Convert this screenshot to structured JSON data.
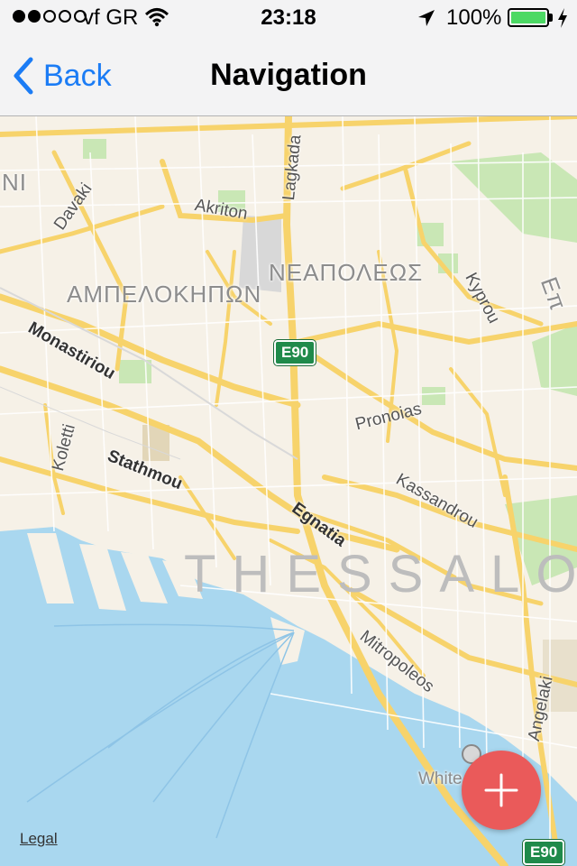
{
  "status_bar": {
    "carrier": "vf GR",
    "time": "23:18",
    "battery": "100%",
    "signal_filled": 2,
    "signal_total": 5,
    "icons": [
      "wifi-icon",
      "location-arrow-icon",
      "battery-icon",
      "charging-icon"
    ]
  },
  "nav": {
    "back_label": "Back",
    "title": "Navigation"
  },
  "map": {
    "streets": [
      "Lagkada",
      "Akriton",
      "Davaki",
      "Monastiriou",
      "Koletti",
      "Stathmou",
      "Egnatia",
      "Kassandrou",
      "Pronoias",
      "Kyprou",
      "Mitropoleos",
      "Angelaki"
    ],
    "areas": [
      "ΝΙ",
      "ΑΜΠΕΛΟΚΗΠΩΝ",
      "ΝΕΑΠΟΛΕΩΣ",
      "Επ"
    ],
    "city": "THESSALONI",
    "shields": [
      "E90",
      "E90"
    ],
    "poi": "White",
    "colors": {
      "water": "#a9d7ef",
      "land": "#f6f1e7",
      "road": "#f7d36b",
      "park": "#c9e7b5"
    }
  },
  "legal": "Legal",
  "fab": {
    "icon": "plus-icon",
    "color": "#ea5a5a"
  }
}
